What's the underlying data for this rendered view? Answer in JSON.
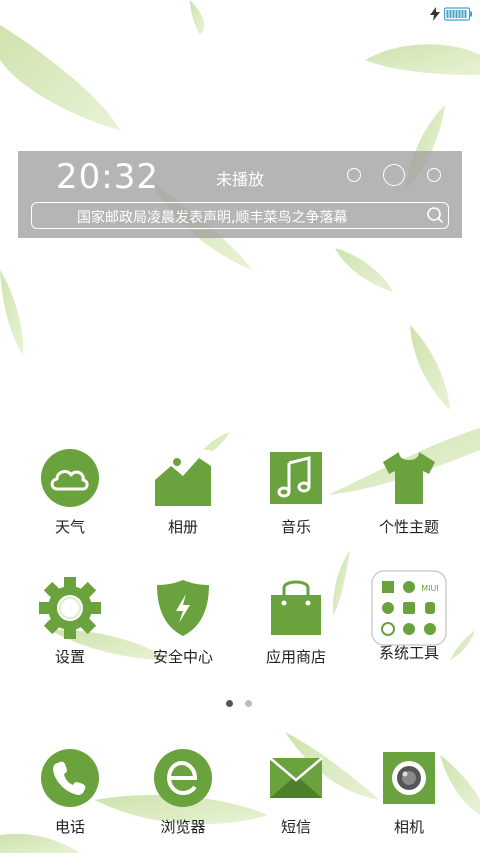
{
  "colors": {
    "icon_green": "#6aa23e",
    "widget_bg": "#a0a0a0",
    "dot_active": "#555555",
    "dot_inactive": "#bbbbbb"
  },
  "statusbar": {
    "charging_icon": "bolt-icon",
    "battery_icon": "battery-icon"
  },
  "widget": {
    "time": "20:32",
    "music_status": "未播放",
    "search_text": "国家邮政局凌晨发表声明,顺丰菜鸟之争落幕"
  },
  "apps": [
    {
      "label": "天气",
      "icon": "weather-icon"
    },
    {
      "label": "相册",
      "icon": "gallery-icon"
    },
    {
      "label": "音乐",
      "icon": "music-icon"
    },
    {
      "label": "个性主题",
      "icon": "theme-icon"
    },
    {
      "label": "设置",
      "icon": "settings-icon"
    },
    {
      "label": "安全中心",
      "icon": "security-icon"
    },
    {
      "label": "应用商店",
      "icon": "app-store-icon"
    },
    {
      "label": "系统工具",
      "icon": "system-tools-folder-icon"
    }
  ],
  "tools_folder": {
    "miui_text": "MIUI"
  },
  "page_indicator": {
    "pages": 2,
    "active": 1
  },
  "dock": [
    {
      "label": "电话",
      "icon": "phone-icon"
    },
    {
      "label": "浏览器",
      "icon": "browser-icon"
    },
    {
      "label": "短信",
      "icon": "messages-icon"
    },
    {
      "label": "相机",
      "icon": "camera-icon"
    }
  ]
}
